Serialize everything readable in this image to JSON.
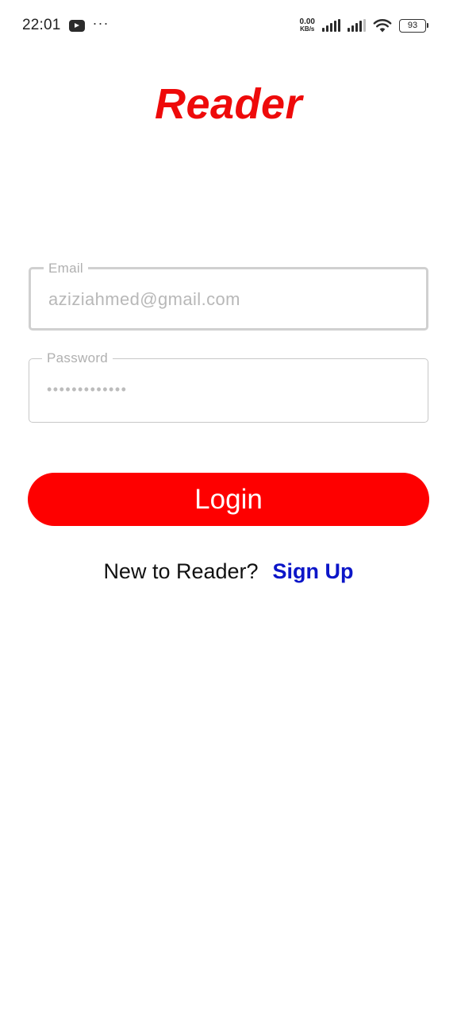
{
  "status_bar": {
    "time": "22:01",
    "net_speed_value": "0.00",
    "net_speed_unit": "KB/s",
    "battery": "93",
    "icons": [
      "youtube-icon",
      "more-dots-icon",
      "signal-icon",
      "signal-icon",
      "wifi-icon",
      "battery-icon"
    ]
  },
  "app": {
    "title": "Reader",
    "title_color": "#ee0a0a"
  },
  "form": {
    "email": {
      "label": "Email",
      "value": "aziziahmed@gmail.com"
    },
    "password": {
      "label": "Password",
      "value": "•••••••••••••"
    },
    "login_label": "Login",
    "login_color": "#fe0000"
  },
  "signup": {
    "prompt": "New to Reader?",
    "link": "Sign Up",
    "link_color": "#0c16c8"
  }
}
